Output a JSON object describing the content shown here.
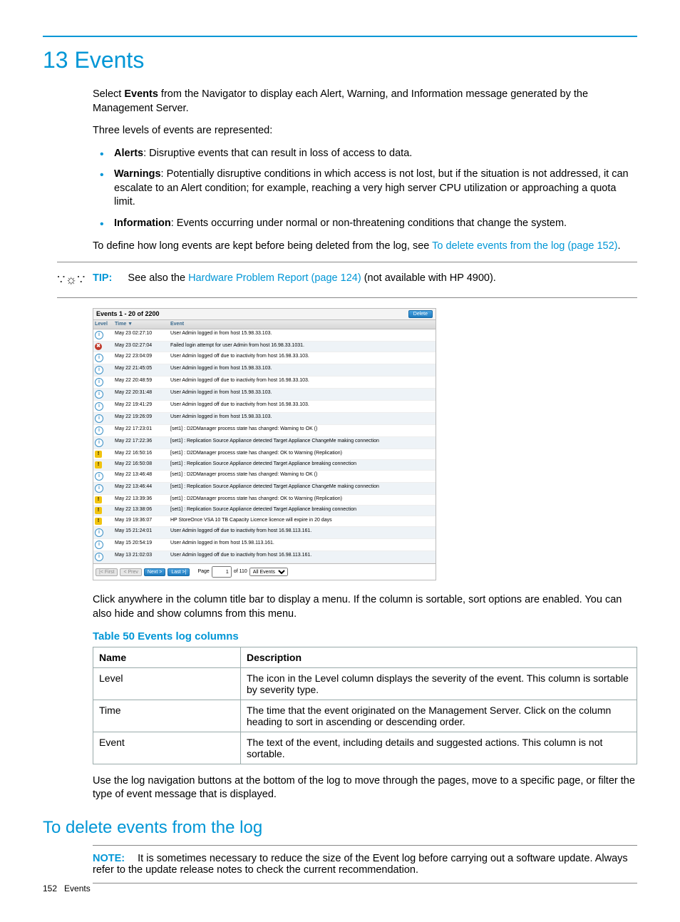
{
  "page": {
    "h1": "13 Events",
    "intro1_a": "Select ",
    "intro1_bold": "Events",
    "intro1_b": " from the Navigator to display each Alert, Warning, and Information message generated by the Management Server.",
    "intro2": "Three levels of events are represented:",
    "bullets": [
      {
        "label": "Alerts",
        "text": ": Disruptive events that can result in loss of access to data."
      },
      {
        "label": "Warnings",
        "text": ": Potentially disruptive conditions in which access is not lost, but if the situation is not addressed, it can escalate to an Alert condition; for example, reaching a very high server CPU utilization or approaching a quota limit."
      },
      {
        "label": "Information",
        "text": ": Events occurring under normal or non-threatening conditions that change the system."
      }
    ],
    "define_a": "To define how long events are kept before being deleted from the log, see ",
    "define_link": "To delete events from the log (page 152)",
    "define_b": ".",
    "tip_label": "TIP:",
    "tip_a": "See also the ",
    "tip_link": "Hardware Problem Report (page 124)",
    "tip_b": " (not available with HP 4900).",
    "after_shot": "Click anywhere in the column title bar to display a menu. If the column is sortable, sort options are enabled. You can also hide and show columns from this menu.",
    "table_title": "Table 50 Events log columns",
    "table_head_name": "Name",
    "table_head_desc": "Description",
    "table_rows": [
      {
        "name": "Level",
        "desc": "The icon in the Level column displays the severity of the event. This column is sortable by severity type."
      },
      {
        "name": "Time",
        "desc": "The time that the event originated on the Management Server. Click on the column heading to sort in ascending or descending order."
      },
      {
        "name": "Event",
        "desc": "The text of the event, including details and suggested actions. This column is not sortable."
      }
    ],
    "after_table": "Use the log navigation buttons at the bottom of the log to move through the pages, move to a specific page, or filter the type of event message that is displayed.",
    "h2": "To delete events from the log",
    "note_label": "NOTE:",
    "note_text": "It is sometimes necessary to reduce the size of the Event log before carrying out a software update. Always refer to the update release notes to check the current recommendation.",
    "footer_num": "152",
    "footer_txt": "Events"
  },
  "events_panel": {
    "title": "Events 1 - 20 of 2200",
    "delete_btn": "Delete",
    "col_level": "Level",
    "col_time": "Time ▼",
    "col_event": "Event",
    "rows": [
      {
        "lvl": "info",
        "time": "May 23 02:27:10",
        "event": "User Admin logged in from host 15.98.33.103."
      },
      {
        "lvl": "alert",
        "time": "May 23 02:27:04",
        "event": "Failed login attempt for user Admin from host 16.98.33.1031."
      },
      {
        "lvl": "info",
        "time": "May 22 23:04:09",
        "event": "User Admin logged off due to inactivity from host 16.98.33.103."
      },
      {
        "lvl": "info",
        "time": "May 22 21:45:05",
        "event": "User Admin logged in from host 15.98.33.103."
      },
      {
        "lvl": "info",
        "time": "May 22 20:48:59",
        "event": "User Admin logged off due to inactivity from host 16.98.33.103."
      },
      {
        "lvl": "info",
        "time": "May 22 20:31:48",
        "event": "User Admin logged in from host 15.98.33.103."
      },
      {
        "lvl": "info",
        "time": "May 22 19:41:29",
        "event": "User Admin logged off due to inactivity from host 16.98.33.103."
      },
      {
        "lvl": "info",
        "time": "May 22 19:26:09",
        "event": "User Admin logged in from host 15.98.33.103."
      },
      {
        "lvl": "info",
        "time": "May 22 17:23:01",
        "event": "[set1] : D2DManager process state has changed: Warning to OK ()"
      },
      {
        "lvl": "info",
        "time": "May 22 17:22:36",
        "event": "[set1] : Replication Source Appliance detected Target Appliance ChangeMe making connection"
      },
      {
        "lvl": "warn",
        "time": "May 22 16:50:16",
        "event": "[set1] : D2DManager process state has changed: OK to Warning (Replication)"
      },
      {
        "lvl": "warn",
        "time": "May 22 16:50:08",
        "event": "[set1] : Replication Source Appliance detected Target Appliance breaking connection"
      },
      {
        "lvl": "info",
        "time": "May 22 13:46:48",
        "event": "[set1] : D2DManager process state has changed: Warning to OK ()"
      },
      {
        "lvl": "info",
        "time": "May 22 13:46:44",
        "event": "[set1] : Replication Source Appliance detected Target Appliance ChangeMe making connection"
      },
      {
        "lvl": "warn",
        "time": "May 22 13:39:36",
        "event": "[set1] : D2DManager process state has changed: OK to Warning (Replication)"
      },
      {
        "lvl": "warn",
        "time": "May 22 13:38:06",
        "event": "[set1] : Replication Source Appliance detected Target Appliance breaking connection"
      },
      {
        "lvl": "warn",
        "time": "May 19 19:36:07",
        "event": "HP StoreOnce VSA 10 TB Capacity Licence licence will expire in 20 days"
      },
      {
        "lvl": "info",
        "time": "May 15 21:24:01",
        "event": "User Admin logged off due to inactivity from host 16.98.113.161."
      },
      {
        "lvl": "info",
        "time": "May 15 20:54:19",
        "event": "User Admin logged in from host 15.98.113.161."
      },
      {
        "lvl": "info",
        "time": "May 13 21:02:03",
        "event": "User Admin logged off due to inactivity from host 16.98.113.161."
      }
    ],
    "pager": {
      "first": "|< First",
      "prev": "< Prev",
      "next": "Next >",
      "last": "Last >|",
      "page_label": "Page",
      "page_value": "1",
      "of_label": "of 110",
      "filter": "All Events"
    }
  }
}
